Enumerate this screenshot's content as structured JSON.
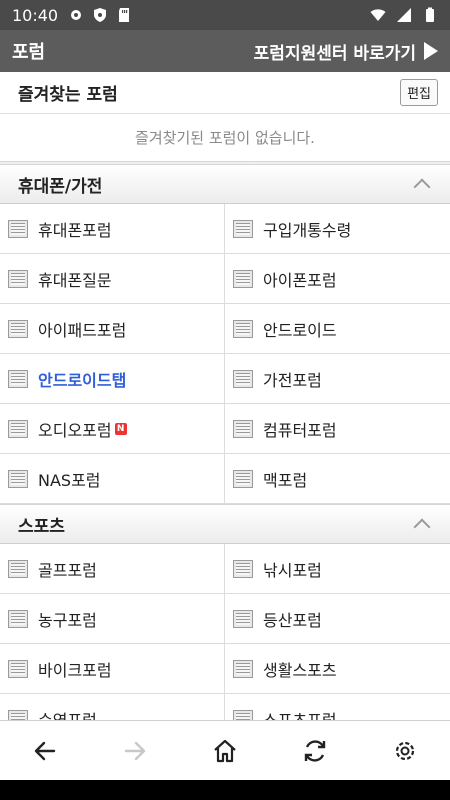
{
  "status_bar": {
    "time": "10:40"
  },
  "header": {
    "title": "포럼",
    "support_link": "포럼지원센터 바로가기"
  },
  "favorites": {
    "title": "즐겨찾는 포럼",
    "edit_label": "편집",
    "empty_message": "즐겨찾기된 포럼이 없습니다."
  },
  "categories": [
    {
      "title": "휴대폰/가전",
      "items": [
        {
          "label": "휴대폰포럼"
        },
        {
          "label": "구입개통수령"
        },
        {
          "label": "휴대폰질문"
        },
        {
          "label": "아이폰포럼"
        },
        {
          "label": "아이패드포럼"
        },
        {
          "label": "안드로이드"
        },
        {
          "label": "안드로이드탭",
          "highlight": true
        },
        {
          "label": "가전포럼"
        },
        {
          "label": "오디오포럼",
          "badge": "N"
        },
        {
          "label": "컴퓨터포럼"
        },
        {
          "label": "NAS포럼"
        },
        {
          "label": "맥포럼"
        }
      ]
    },
    {
      "title": "스포츠",
      "items": [
        {
          "label": "골프포럼"
        },
        {
          "label": "낚시포럼"
        },
        {
          "label": "농구포럼"
        },
        {
          "label": "등산포럼"
        },
        {
          "label": "바이크포럼"
        },
        {
          "label": "생활스포츠"
        },
        {
          "label": "수영포럼"
        },
        {
          "label": "스포츠포럼"
        }
      ]
    }
  ],
  "colors": {
    "header_bg": "#5c5c5c",
    "status_bg": "#4a4a4a",
    "highlight": "#2f5fd8",
    "badge": "#e33333"
  },
  "toolbar_icons": [
    "back-arrow-icon",
    "forward-arrow-icon",
    "home-icon",
    "refresh-icon",
    "settings-gear-icon"
  ]
}
